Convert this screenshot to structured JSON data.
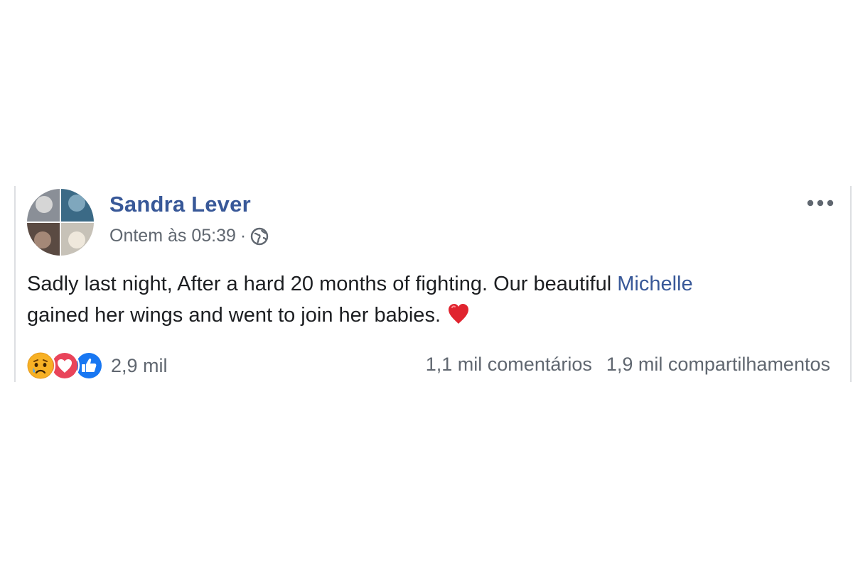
{
  "post": {
    "author": "Sandra Lever",
    "time": "Ontem às 05:39",
    "separator": "·",
    "privacy_icon": "globe-icon",
    "menu_icon": "more-options-icon",
    "text_part1": "Sadly last night, After a hard 20 months of fighting. Our beautiful ",
    "mention": "Michelle",
    "text_part2": " gained her wings and went to join her babies.",
    "text_emoji": "heart-icon",
    "reactions": [
      "sad-reaction-icon",
      "love-reaction-icon",
      "like-reaction-icon"
    ],
    "reaction_count": "2,9 mil",
    "comments": "1,1 mil comentários",
    "shares": "1,9 mil compartilhamentos"
  },
  "colors": {
    "link": "#385898",
    "secondary_text": "#606770",
    "love": "#e9445a",
    "like": "#1877f2",
    "sad": "#f7b125"
  }
}
